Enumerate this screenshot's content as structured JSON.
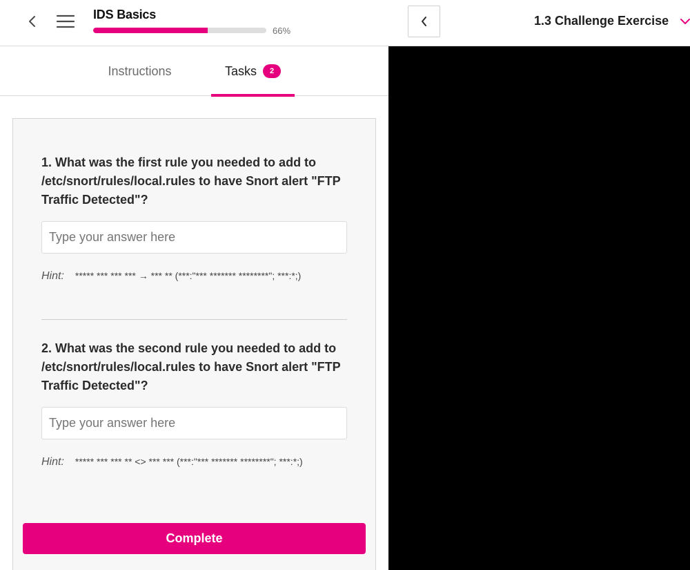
{
  "header": {
    "back_icon": "chevron-left-icon",
    "menu_icon": "hamburger-menu-icon",
    "course_title": "IDS Basics",
    "progress_percent": 66,
    "progress_label": "66%",
    "panel_prev_icon": "chevron-left-icon",
    "lesson_title": "1.3 Challenge Exercise",
    "lesson_dropdown_icon": "chevron-down-icon"
  },
  "tabs": [
    {
      "label": "Instructions",
      "active": false
    },
    {
      "label": "Tasks",
      "active": true,
      "badge": "2"
    }
  ],
  "tasks": [
    {
      "question": "1. What was the first rule you needed to add to /etc/snort/rules/local.rules to have Snort alert \"FTP Traffic Detected\"?",
      "answer_value": "",
      "placeholder": "Type your answer here",
      "hint_label": "Hint:",
      "hint_text": "***** *** *** *** → *** ** (***:\"*** ******* ********\"; ***:*;)"
    },
    {
      "question": "2. What was the second rule you needed to add to /etc/snort/rules/local.rules to have Snort alert \"FTP Traffic Detected\"?",
      "answer_value": "",
      "placeholder": "Type your answer here",
      "hint_label": "Hint:",
      "hint_text": "***** *** *** ** <> *** *** (***:\"*** ******* ********\"; ***:*;)"
    }
  ],
  "complete_label": "Complete",
  "colors": {
    "accent": "#e6007e",
    "progress_track": "#dedede",
    "card_background": "#f7f7f7",
    "terminal_background": "#000000"
  }
}
